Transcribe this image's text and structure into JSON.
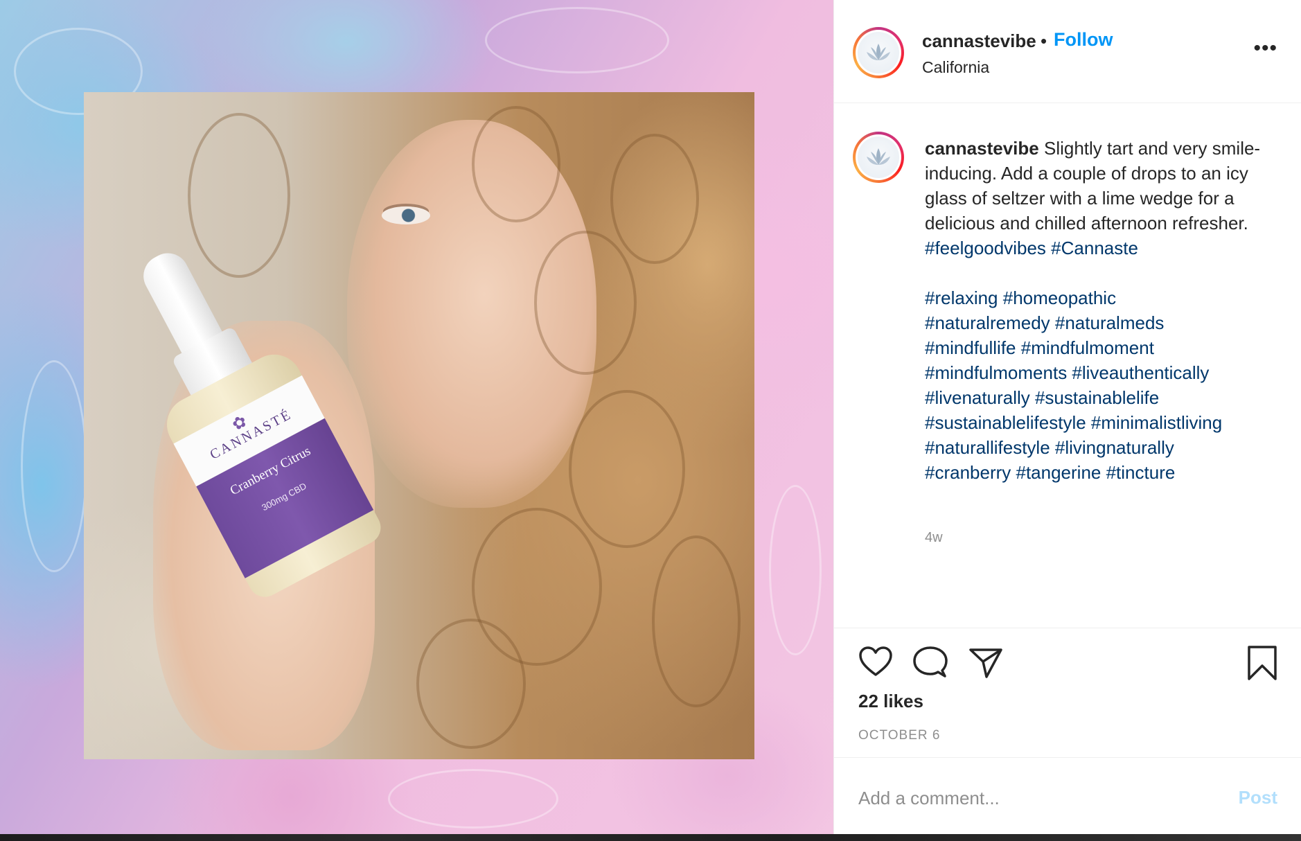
{
  "post": {
    "image_alt": "Woman holding CBD tincture bottle",
    "product": {
      "brand": "CANNASTÉ",
      "flavor": "Cranberry Citrus",
      "dose": "300mg CBD"
    }
  },
  "header": {
    "username": "cannastevibe",
    "separator": "•",
    "follow_label": "Follow",
    "location": "California",
    "more_label": "•••"
  },
  "caption": {
    "username": "cannastevibe",
    "text": "Slightly tart and very smile-inducing. Add a couple of drops to an icy glass of seltzer with a lime wedge for a delicious and chilled afternoon refresher.",
    "inline_tags": [
      "#feelgoodvibes",
      "#Cannaste"
    ],
    "hashtag_lines": [
      "#relaxing #homeopathic",
      "#naturalremedy #naturalmeds",
      "#mindfullife #mindfulmoment",
      "#mindfulmoments #liveauthentically",
      "#livenaturally #sustainablelife",
      "#sustainablelifestyle #minimalistliving",
      "#naturallifestyle #livingnaturally",
      "#cranberry #tangerine #tincture"
    ],
    "time_ago": "4w"
  },
  "actions": {
    "like_icon": "heart-icon",
    "comment_icon": "comment-icon",
    "share_icon": "share-icon",
    "save_icon": "bookmark-icon"
  },
  "stats": {
    "likes": "22 likes",
    "date": "OCTOBER 6"
  },
  "comment": {
    "placeholder": "Add a comment...",
    "post_label": "Post"
  },
  "colors": {
    "link_blue": "#0095f6",
    "hashtag": "#00376b",
    "post_disabled": "#b2dffc",
    "muted": "#8e8e8e"
  }
}
